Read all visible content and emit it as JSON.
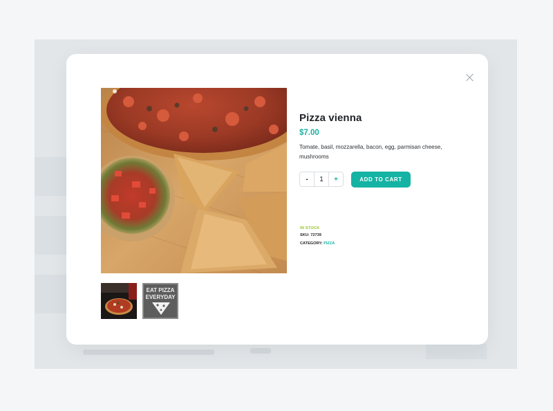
{
  "product": {
    "title": "Pizza vienna",
    "price": "$7.00",
    "description": "Tomate, basil, mozzarella, bacon, egg, parmisan cheese, mushrooms",
    "quantity": "1",
    "minus_label": "-",
    "plus_label": "+",
    "add_to_cart_label": "ADD TO CART",
    "stock_status": "IN STOCK",
    "sku_label": "SKU:",
    "sku_value": "72739",
    "category_label": "CATEGORY:",
    "category_value": "PIZZA",
    "thumbnail_2_text_line1": "EAT PIZZA",
    "thumbnail_2_text_line2": "EVERYDAY"
  },
  "icons": {
    "close": "close-icon"
  },
  "colors": {
    "accent": "#14b3a3",
    "stock": "#9ac12a",
    "title": "#1f2328"
  }
}
